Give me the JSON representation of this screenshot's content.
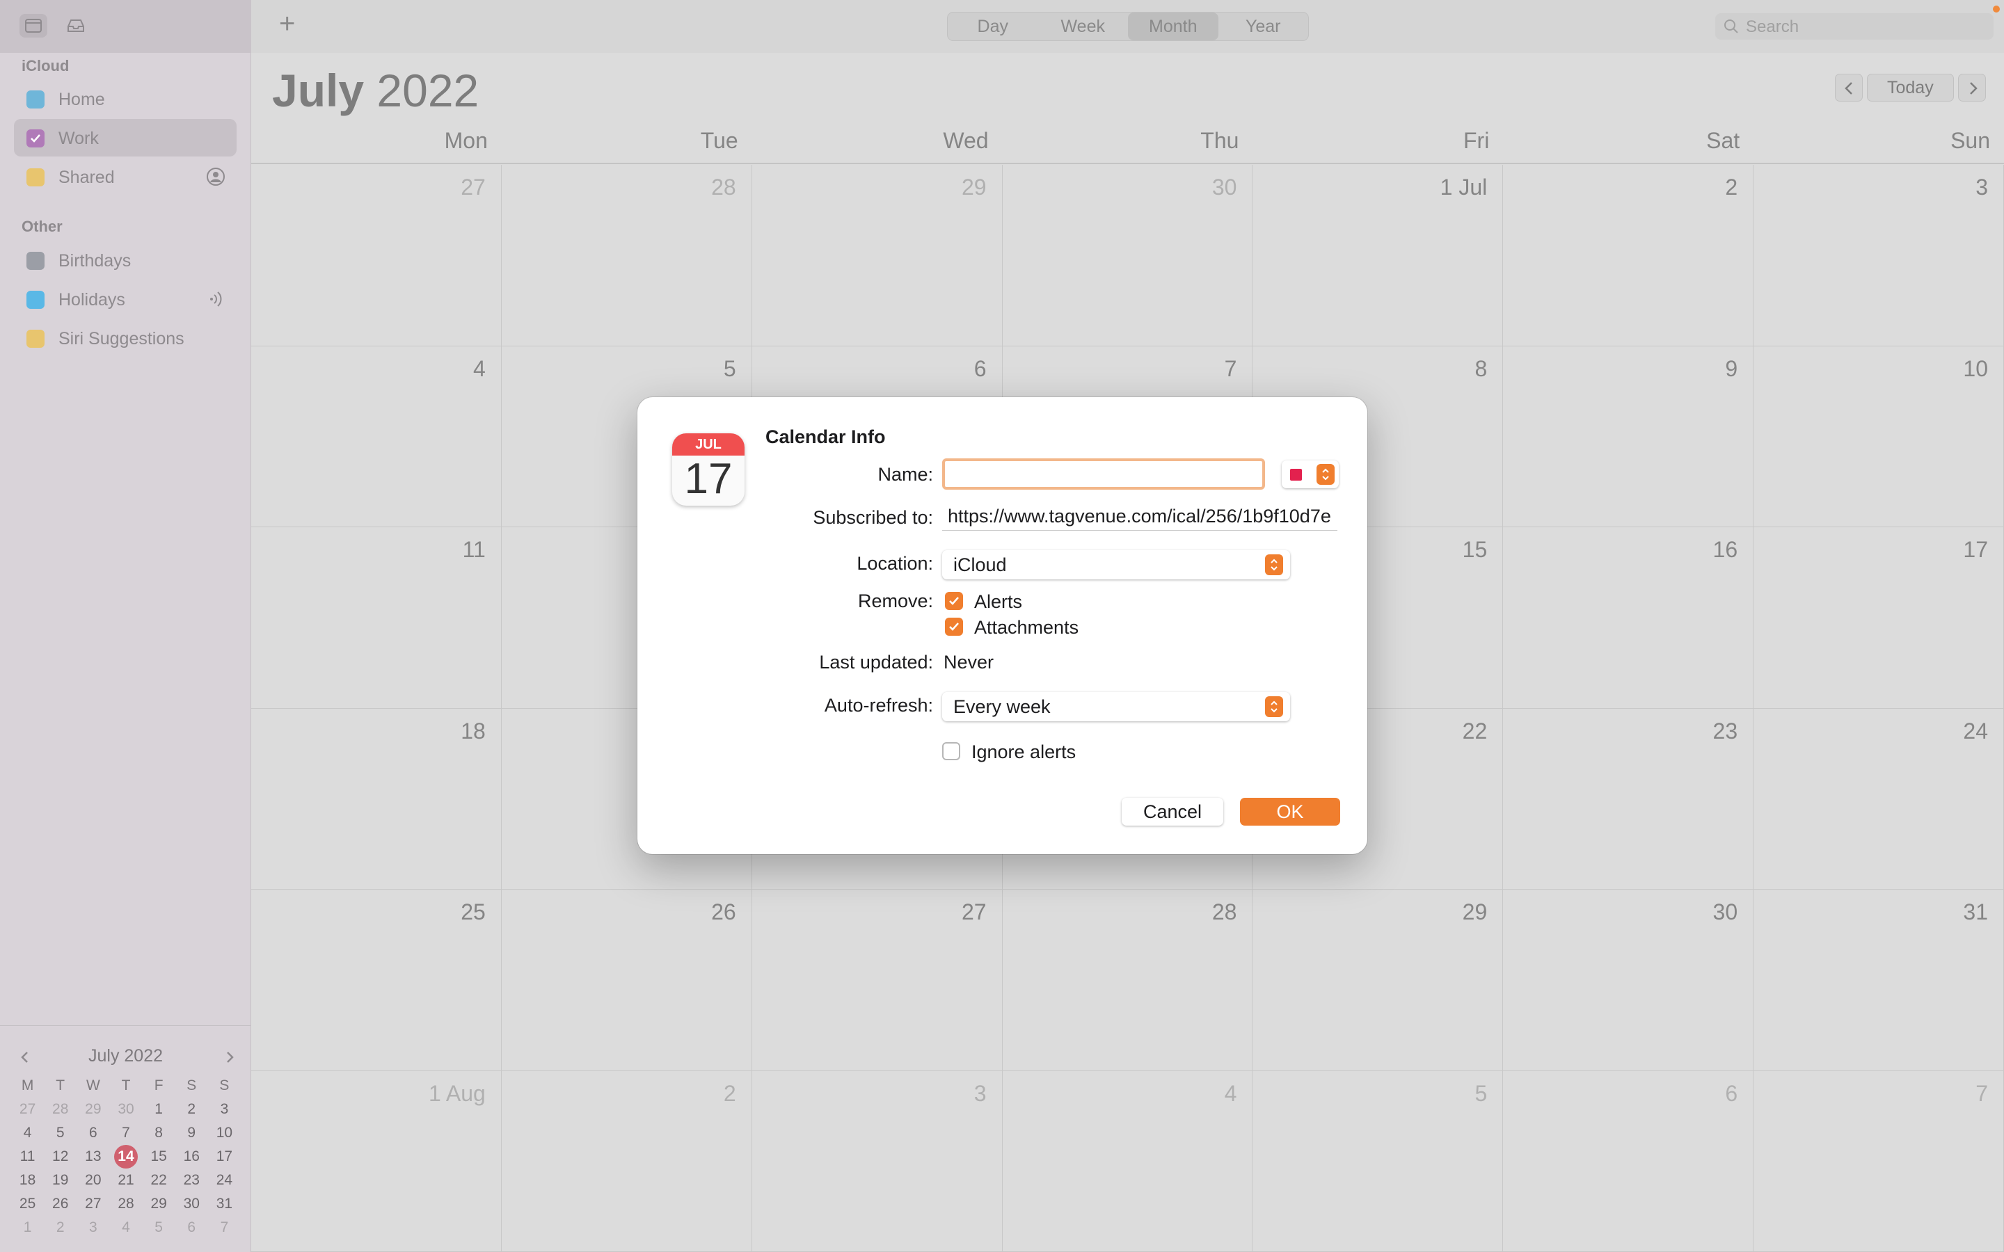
{
  "sidebar": {
    "sections": [
      {
        "title": "iCloud",
        "items": [
          {
            "label": "Home",
            "color": "#6fb6d9",
            "checked": false
          },
          {
            "label": "Work",
            "color": "#b07ab8",
            "checked": true
          },
          {
            "label": "Shared",
            "color": "#e8c56e",
            "checked": false
          }
        ]
      },
      {
        "title": "Other",
        "items": [
          {
            "label": "Birthdays",
            "color": "#9b9ea6",
            "checked": false
          },
          {
            "label": "Holidays",
            "color": "#5ab8e6",
            "checked": false
          },
          {
            "label": "Siri Suggestions",
            "color": "#e8c56e",
            "checked": false
          }
        ]
      }
    ],
    "mini_calendar": {
      "title": "July 2022",
      "weekdays": [
        "M",
        "T",
        "W",
        "T",
        "F",
        "S",
        "S"
      ],
      "rows": [
        [
          "27",
          "28",
          "29",
          "30",
          "1",
          "2",
          "3"
        ],
        [
          "4",
          "5",
          "6",
          "7",
          "8",
          "9",
          "10"
        ],
        [
          "11",
          "12",
          "13",
          "14",
          "15",
          "16",
          "17"
        ],
        [
          "18",
          "19",
          "20",
          "21",
          "22",
          "23",
          "24"
        ],
        [
          "25",
          "26",
          "27",
          "28",
          "29",
          "30",
          "31"
        ],
        [
          "1",
          "2",
          "3",
          "4",
          "5",
          "6",
          "7"
        ]
      ],
      "today": "14"
    }
  },
  "toolbar": {
    "views": [
      "Day",
      "Week",
      "Month",
      "Year"
    ],
    "active_view": "Month",
    "search_placeholder": "Search",
    "today_label": "Today"
  },
  "calendar": {
    "month": "July",
    "year": "2022",
    "weekdays": [
      "Mon",
      "Tue",
      "Wed",
      "Thu",
      "Fri",
      "Sat",
      "Sun"
    ],
    "weeks": [
      [
        "27",
        "28",
        "29",
        "30",
        "1 Jul",
        "2",
        "3"
      ],
      [
        "4",
        "5",
        "6",
        "7",
        "8",
        "9",
        "10"
      ],
      [
        "11",
        "12",
        "13",
        "14",
        "15",
        "16",
        "17"
      ],
      [
        "18",
        "19",
        "20",
        "21",
        "22",
        "23",
        "24"
      ],
      [
        "25",
        "26",
        "27",
        "28",
        "29",
        "30",
        "31"
      ],
      [
        "1 Aug",
        "2",
        "3",
        "4",
        "5",
        "6",
        "7"
      ]
    ]
  },
  "dialog": {
    "title": "Calendar Info",
    "icon_month": "JUL",
    "icon_day": "17",
    "name_label": "Name:",
    "name_value": "",
    "color": "#e3214e",
    "subscribed_label": "Subscribed to:",
    "subscribed_url": "https://www.tagvenue.com/ical/256/1b9f10d7e",
    "location_label": "Location:",
    "location_value": "iCloud",
    "remove_label": "Remove:",
    "remove_alerts": "Alerts",
    "remove_attachments": "Attachments",
    "last_updated_label": "Last updated:",
    "last_updated_value": "Never",
    "autorefresh_label": "Auto-refresh:",
    "autorefresh_value": "Every week",
    "ignore_alerts_label": "Ignore alerts",
    "cancel_label": "Cancel",
    "ok_label": "OK"
  }
}
